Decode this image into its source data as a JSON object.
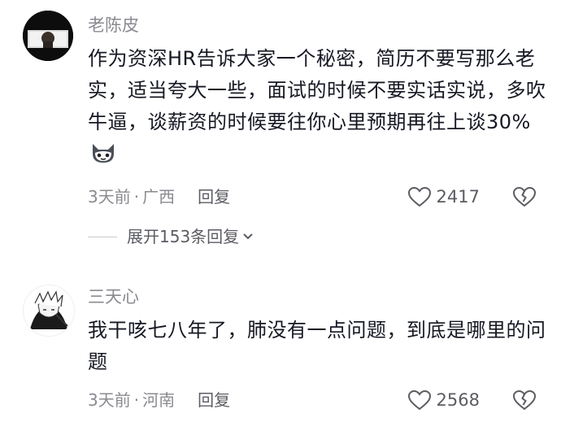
{
  "comments": [
    {
      "username": "老陈皮",
      "text": "作为资深HR告诉大家一个秘密，简历不要写那么老实，适当夸大一些，面试的时候不要实话实说，多吹牛逼，谈薪资的时候要往你心里预期再往上谈30%",
      "emoji": "fox-emoji",
      "time": "3天前",
      "separator": "·",
      "location": "广西",
      "reply_label": "回复",
      "likes": "2417",
      "expand_label": "展开153条回复"
    },
    {
      "username": "三天心",
      "text": "我干咳七八年了，肺没有一点问题，到底是哪里的问题",
      "time": "3天前",
      "separator": "·",
      "location": "河南",
      "reply_label": "回复",
      "likes": "2568"
    }
  ],
  "colors": {
    "text": "#161823",
    "muted": "#8a8b91",
    "action": "#5b5c63"
  }
}
